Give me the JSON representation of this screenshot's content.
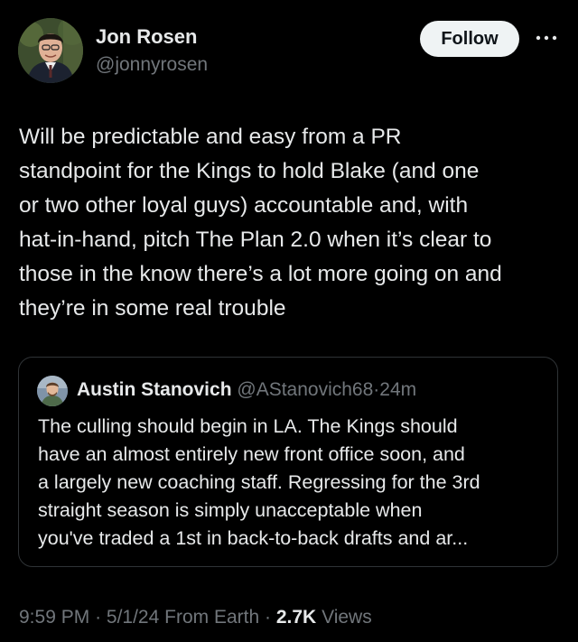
{
  "author": {
    "name": "Jon Rosen",
    "handle": "@jonnyrosen",
    "avatar_icon": "profile-photo"
  },
  "actions": {
    "follow_label": "Follow",
    "more_icon": "more-horizontal-icon"
  },
  "tweet": {
    "text": "Will be predictable and easy from a PR\nstandpoint for the Kings to hold Blake (and one\nor two other loyal guys) accountable and, with\nhat-in-hand, pitch The Plan 2.0 when it’s clear to\nthose in the know there’s a lot more going on and\nthey’re in some real trouble"
  },
  "quote": {
    "name": "Austin Stanovich",
    "handle": "@AStanovich68",
    "separator": "·",
    "time": "24m",
    "text": "The culling should begin in LA. The Kings should\nhave an almost entirely new front office soon, and\na largely new coaching staff. Regressing for the 3rd\nstraight season is simply unacceptable when\nyou've traded a 1st in back-to-back drafts and ar..."
  },
  "meta": {
    "time": "9:59 PM",
    "sep1": "·",
    "date": "5/1/24",
    "location": "From Earth",
    "sep2": "·",
    "views_count": "2.7K",
    "views_label": "Views"
  },
  "colors": {
    "background": "#000000",
    "text": "#e7e9ea",
    "secondary": "#71767b",
    "border": "#2f3336",
    "button_bg": "#eff3f4"
  }
}
